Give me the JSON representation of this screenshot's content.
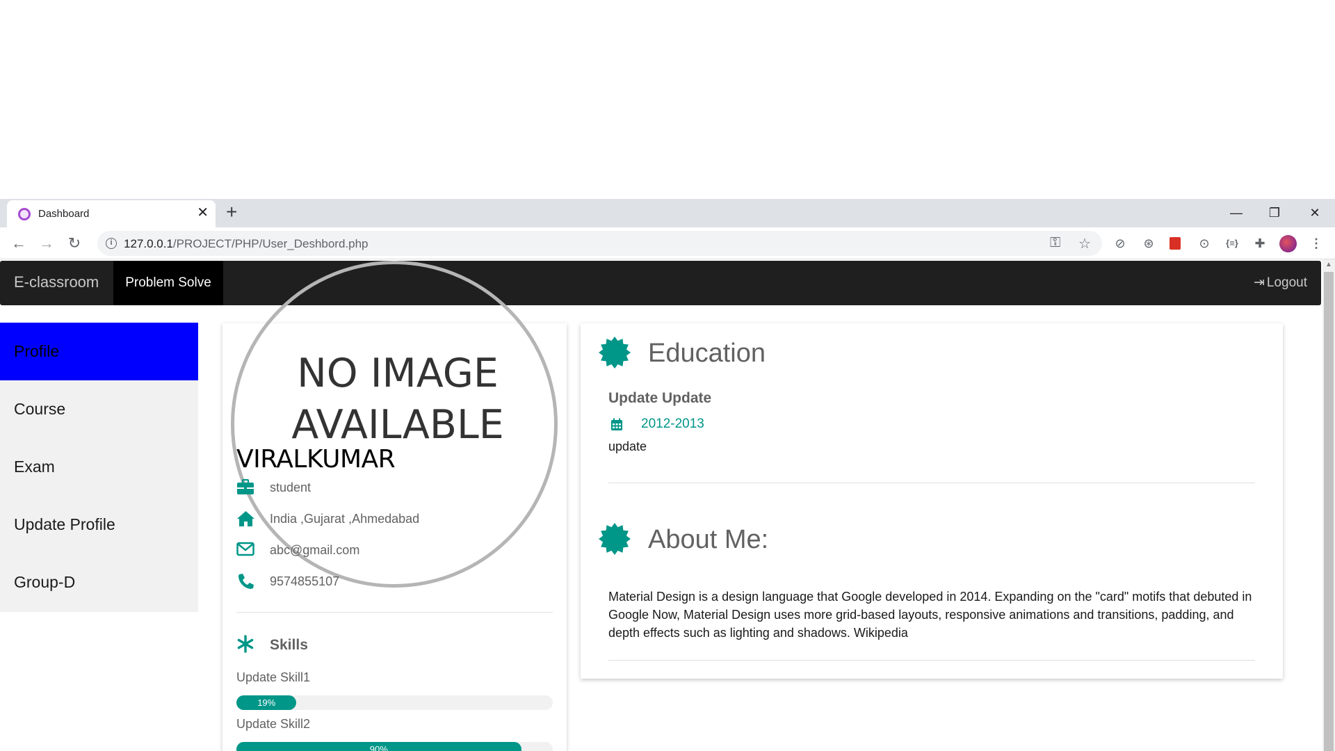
{
  "browser": {
    "tab_title": "Dashboard",
    "tab_close": "✕",
    "new_tab": "+",
    "url_host": "127.0.0.1",
    "url_path": "/PROJECT/PHP/User_Deshbord.php",
    "window_controls": {
      "minimize": "—",
      "restore": "❐",
      "close": "✕"
    }
  },
  "navbar": {
    "brand": "E-classroom",
    "active_item": "Problem Solve",
    "logout_label": "Logout"
  },
  "sidebar": {
    "items": [
      {
        "label": "Profile",
        "active": true
      },
      {
        "label": "Course"
      },
      {
        "label": "Exam"
      },
      {
        "label": "Update Profile"
      },
      {
        "label": "Group-D"
      }
    ]
  },
  "profile": {
    "image_placeholder_line1": "NO IMAGE",
    "image_placeholder_line2": "AVAILABLE",
    "name": "VIRALKUMAR",
    "role": "student",
    "location": "India ,Gujarat ,Ahmedabad",
    "email": "abc@gmail.com",
    "phone": "9574855107",
    "skills_title": "Skills",
    "skills": [
      {
        "name": "Update Skill1",
        "percent": 19,
        "percent_label": "19%"
      },
      {
        "name": "Update Skill2",
        "percent": 90,
        "percent_label": "90%"
      }
    ]
  },
  "education": {
    "title": "Education",
    "degree": "Update Update",
    "years": "2012-2013",
    "description": "update"
  },
  "about": {
    "title": "About Me:",
    "text": "Material Design is a design language that Google developed in 2014. Expanding on the \"card\" motifs that debuted in Google Now, Material Design uses more grid-based layouts, responsive animations and transitions, padding, and depth effects such as lighting and shadows. Wikipedia"
  },
  "colors": {
    "accent": "#009688",
    "sidebar_active": "#0000ff",
    "navbar": "#1f1f1f"
  },
  "icons": {
    "role": "briefcase-icon",
    "location": "home-icon",
    "email": "envelope-icon",
    "phone": "phone-icon",
    "skills": "asterisk-icon",
    "section": "certificate-icon",
    "date": "calendar-icon"
  }
}
